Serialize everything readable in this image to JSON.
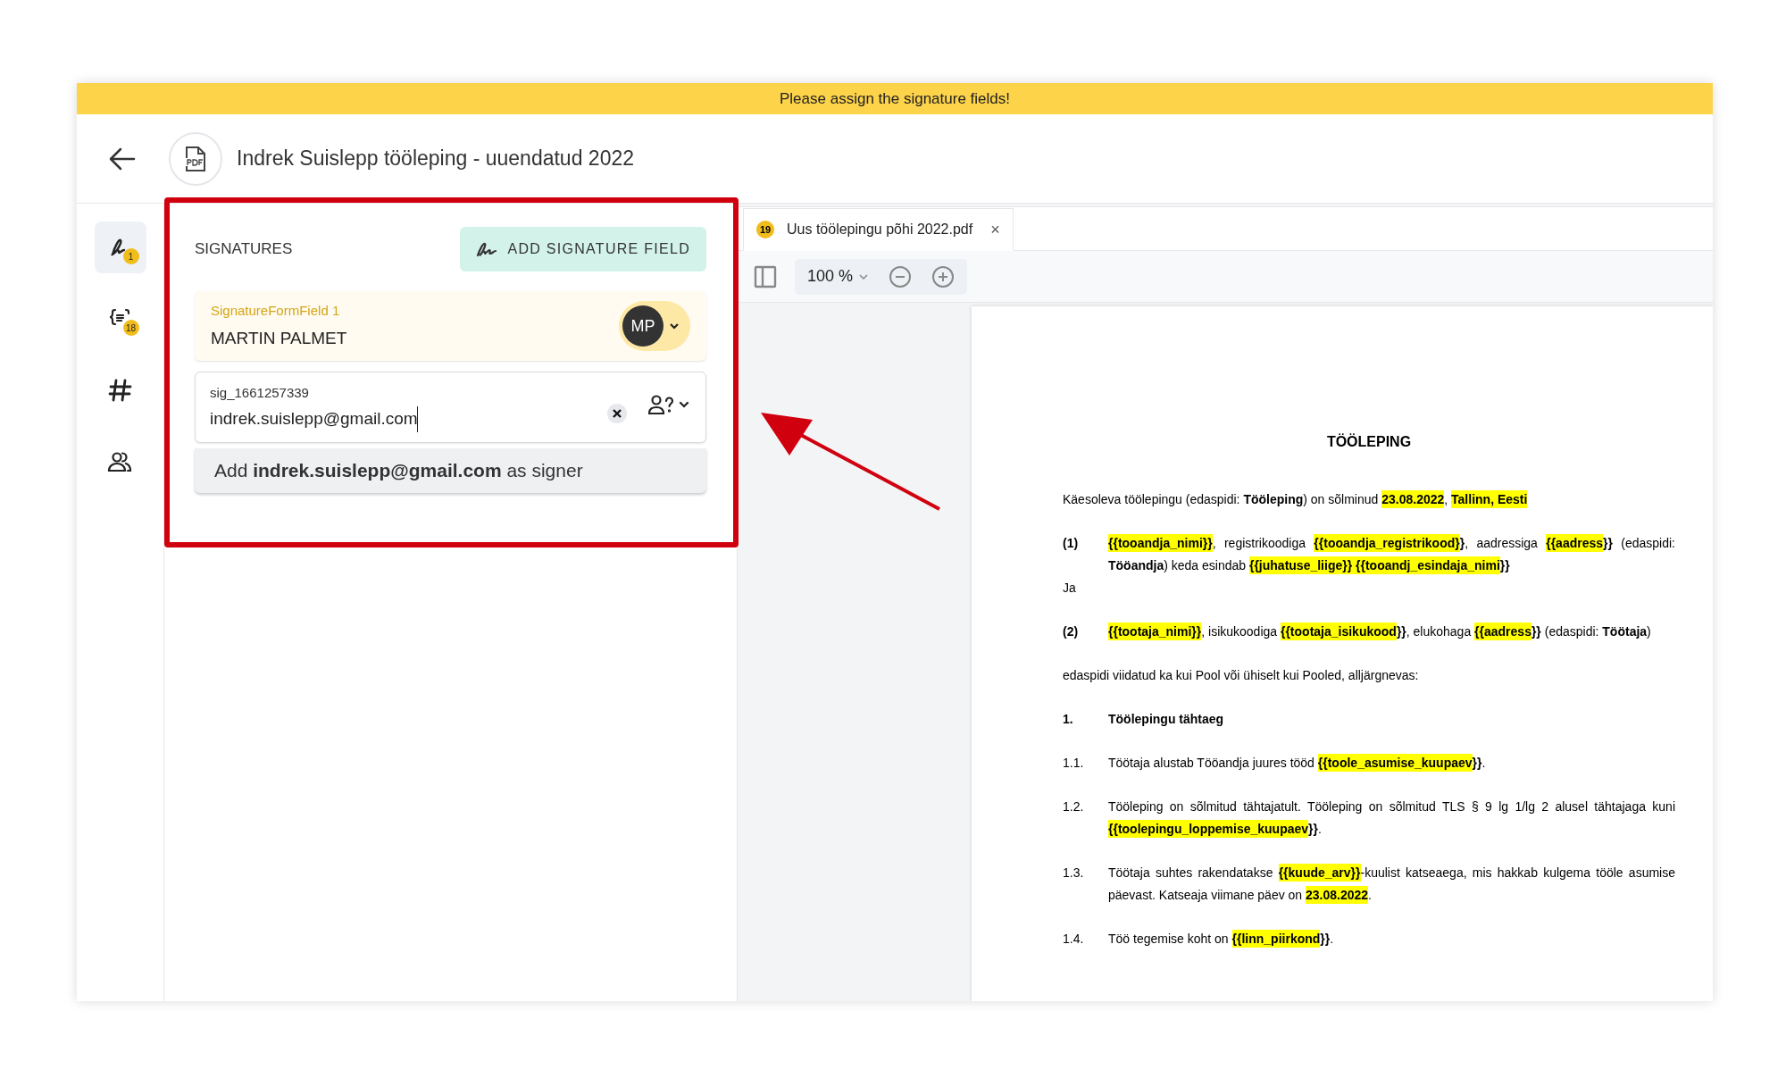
{
  "banner": {
    "text": "Please assign the signature fields!"
  },
  "header": {
    "title": "Indrek Suislepp tööleping - uuendatud 2022"
  },
  "rail": [
    {
      "badge": "1",
      "selected": true
    },
    {
      "badge": "18",
      "selected": false
    },
    {
      "selected": false
    },
    {
      "selected": false
    }
  ],
  "signatures": {
    "title": "SIGNATURES",
    "add_button": "ADD SIGNATURE FIELD",
    "items": [
      {
        "kind": "assigned",
        "field": "SignatureFormField 1",
        "signer": "MARTIN PALMET",
        "avatar": "MP"
      },
      {
        "kind": "editing",
        "field": "sig_1661257339",
        "value": "indrek.suislepp@gmail.com",
        "suggestion": "Add **indrek.suislepp@gmail.com** as signer"
      }
    ]
  },
  "viewer": {
    "tab": {
      "badge": "19",
      "label": "Uus töölepingu põhi 2022.pdf",
      "close": "×"
    },
    "zoom": "100 %",
    "document": [
      {
        "kind": "title",
        "runs": [
          {
            "text": "TÖÖLEPING",
            "highlight": false
          }
        ]
      },
      {
        "kind": "para",
        "runs": [
          {
            "text": "Käesoleva töölepingu (edaspidi: **Tööleping**) on sõlminud ",
            "highlight": false
          },
          {
            "text": "**23.08.2022**",
            "highlight": true
          },
          {
            "text": ", ",
            "highlight": false
          },
          {
            "text": "**Tallinn, Eesti**",
            "highlight": true
          }
        ]
      },
      {
        "kind": "clause",
        "number": "(1)",
        "number_bold": true,
        "runs": [
          {
            "text": "**{{tooandja_nimi}}**",
            "highlight": true
          },
          {
            "text": ", registrikoodiga ",
            "highlight": false
          },
          {
            "text": "**{{tooandja_registrikood}**",
            "highlight": true
          },
          {
            "text": "**}**, aadressiga ",
            "highlight": false
          },
          {
            "text": "**{{aadress**",
            "highlight": true
          },
          {
            "text": "**}}** (edaspidi: **Tööandja**) keda esindab ",
            "highlight": false
          },
          {
            "text": "**{{juhatuse_liige}}** ",
            "highlight": true
          },
          {
            "text": "**{{tooandj_esindaja_nimi**",
            "highlight": true
          },
          {
            "text": "**}}**",
            "highlight": false
          }
        ]
      },
      {
        "kind": "plain",
        "runs": [
          {
            "text": "Ja",
            "highlight": false
          }
        ]
      },
      {
        "kind": "clause",
        "number": "(2)",
        "number_bold": true,
        "runs": [
          {
            "text": "**{{tootaja_nimi}}**",
            "highlight": true
          },
          {
            "text": ", isikukoodiga ",
            "highlight": false
          },
          {
            "text": "**{{tootaja_isikukood**",
            "highlight": true
          },
          {
            "text": "**}}**, elukohaga ",
            "highlight": false
          },
          {
            "text": "**{{aadress**",
            "highlight": true
          },
          {
            "text": "**}}** (edaspidi: **Töötaja**)",
            "highlight": false
          }
        ]
      },
      {
        "kind": "para",
        "runs": [
          {
            "text": "edaspidi viidatud ka kui Pool või ühiselt kui Pooled, alljärgnevas:",
            "highlight": false
          }
        ]
      },
      {
        "kind": "section",
        "number": "1.",
        "number_bold": true,
        "runs": [
          {
            "text": "Töölepingu tähtaeg",
            "highlight": false
          }
        ]
      },
      {
        "kind": "clause",
        "number": "1.1.",
        "number_bold": false,
        "runs": [
          {
            "text": "Töötaja alustab Tööandja juures tööd ",
            "highlight": false
          },
          {
            "text": "**{{toole_asumise_kuupaev**",
            "highlight": true
          },
          {
            "text": "**}}**.",
            "highlight": false
          }
        ]
      },
      {
        "kind": "clause",
        "number": "1.2.",
        "number_bold": false,
        "runs": [
          {
            "text": "Tööleping on sõlmitud tähtajatult. Tööleping on sõlmitud TLS § 9 lg 1/lg 2 alusel tähtajaga kuni ",
            "highlight": false
          },
          {
            "text": "**{{toolepingu_loppemise_kuupaev**",
            "highlight": true
          },
          {
            "text": "**}}**.",
            "highlight": false
          }
        ]
      },
      {
        "kind": "clause",
        "number": "1.3.",
        "number_bold": false,
        "runs": [
          {
            "text": "Töötaja suhtes rakendatakse ",
            "highlight": false
          },
          {
            "text": "**{{kuude_arv}}**",
            "highlight": true
          },
          {
            "text": "-kuulist katseaega, mis hakkab kulgema tööle asumise päevast. Katseaja viimane päev on ",
            "highlight": false
          },
          {
            "text": "**23.08.2022**",
            "highlight": true
          },
          {
            "text": ".",
            "highlight": false
          }
        ]
      },
      {
        "kind": "clause",
        "number": "1.4.",
        "number_bold": false,
        "runs": [
          {
            "text": "Töö tegemise koht on ",
            "highlight": false
          },
          {
            "text": "**{{linn_piirkond**",
            "highlight": true
          },
          {
            "text": "**}}**.",
            "highlight": false
          }
        ]
      }
    ]
  }
}
